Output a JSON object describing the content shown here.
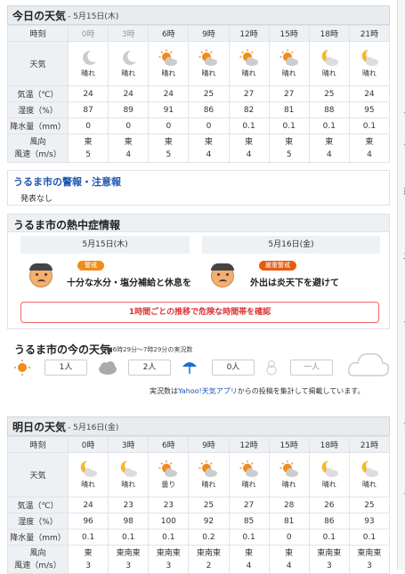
{
  "today": {
    "title": "今日の天気",
    "date": "- 5月15日(木)",
    "header_label": "時刻",
    "rows_labels": {
      "weather": "天気",
      "temp": "気温（℃）",
      "humidity": "湿度（%）",
      "precip": "降水量（mm）",
      "wind_dir": "風向",
      "wind_speed": "風速（m/s）"
    },
    "columns": [
      {
        "time": "0時",
        "dim": true,
        "icon": "moon-icon",
        "weather": "晴れ",
        "temp": "24",
        "humidity": "87",
        "precip": "0",
        "wind_dir": "東",
        "wind_speed": "5"
      },
      {
        "time": "3時",
        "dim": true,
        "icon": "moon-icon",
        "weather": "晴れ",
        "temp": "24",
        "humidity": "89",
        "precip": "0",
        "wind_dir": "東",
        "wind_speed": "4"
      },
      {
        "time": "6時",
        "dim": false,
        "icon": "sun-cloud-icon",
        "weather": "晴れ",
        "temp": "24",
        "humidity": "91",
        "precip": "0",
        "wind_dir": "東",
        "wind_speed": "5"
      },
      {
        "time": "9時",
        "dim": false,
        "icon": "sun-cloud-icon",
        "weather": "晴れ",
        "temp": "25",
        "humidity": "86",
        "precip": "0",
        "wind_dir": "東",
        "wind_speed": "4"
      },
      {
        "time": "12時",
        "dim": false,
        "icon": "sun-cloud-icon",
        "weather": "晴れ",
        "temp": "27",
        "humidity": "82",
        "precip": "0.1",
        "wind_dir": "東",
        "wind_speed": "4"
      },
      {
        "time": "15時",
        "dim": false,
        "icon": "sun-cloud-icon",
        "weather": "晴れ",
        "temp": "27",
        "humidity": "81",
        "precip": "0.1",
        "wind_dir": "東",
        "wind_speed": "5"
      },
      {
        "time": "18時",
        "dim": false,
        "icon": "moon-cloud-icon",
        "weather": "晴れ",
        "temp": "25",
        "humidity": "88",
        "precip": "0.1",
        "wind_dir": "東",
        "wind_speed": "4"
      },
      {
        "time": "21時",
        "dim": false,
        "icon": "moon-cloud-icon",
        "weather": "晴れ",
        "temp": "24",
        "humidity": "95",
        "precip": "0.1",
        "wind_dir": "東",
        "wind_speed": "4"
      }
    ]
  },
  "warnings": {
    "title": "うるま市の警報・注意報",
    "text": "発表なし"
  },
  "heat": {
    "title": "うるま市の熱中症情報",
    "day1": {
      "date": "5月15日(木)",
      "level": "警戒",
      "message": "十分な水分・塩分補給と休息を"
    },
    "day2": {
      "date": "5月16日(金)",
      "level": "厳重警戒",
      "message": "外出は炎天下を避けて"
    },
    "link": "1時間ごとの推移で危険な時間帯を確認"
  },
  "now": {
    "title": "うるま市の今の天気",
    "subtitle": "■6時29分〜7時29分の実況数",
    "counts": [
      "1人",
      "2人",
      "0人",
      "一人"
    ],
    "note_pre": "実況数は",
    "note_link": "Yahoo!天気アプリ",
    "note_post": "からの投稿を集計して掲載しています。"
  },
  "tomorrow": {
    "title": "明日の天気",
    "date": "- 5月16日(金)",
    "header_label": "時刻",
    "rows_labels": {
      "weather": "天気",
      "temp": "気温（℃）",
      "humidity": "湿度（%）",
      "precip": "降水量（mm）",
      "wind_dir": "風向",
      "wind_speed": "風速（m/s）"
    },
    "columns": [
      {
        "time": "0時",
        "icon": "moon-cloud-icon",
        "weather": "晴れ",
        "temp": "24",
        "humidity": "96",
        "precip": "0.1",
        "wind_dir": "東",
        "wind_speed": "3"
      },
      {
        "time": "3時",
        "icon": "moon-cloud-icon",
        "weather": "晴れ",
        "temp": "23",
        "humidity": "98",
        "precip": "0.1",
        "wind_dir": "東南東",
        "wind_speed": "3"
      },
      {
        "time": "6時",
        "icon": "sun-cloud-icon",
        "weather": "曇り",
        "temp": "23",
        "humidity": "100",
        "precip": "0.1",
        "wind_dir": "東南東",
        "wind_speed": "3"
      },
      {
        "time": "9時",
        "icon": "sun-cloud-icon",
        "weather": "晴れ",
        "temp": "25",
        "humidity": "92",
        "precip": "0.2",
        "wind_dir": "東南東",
        "wind_speed": "2"
      },
      {
        "time": "12時",
        "icon": "sun-cloud-icon",
        "weather": "晴れ",
        "temp": "27",
        "humidity": "85",
        "precip": "0.1",
        "wind_dir": "東",
        "wind_speed": "4"
      },
      {
        "time": "15時",
        "icon": "sun-cloud-icon",
        "weather": "晴れ",
        "temp": "28",
        "humidity": "81",
        "precip": "0",
        "wind_dir": "東",
        "wind_speed": "4"
      },
      {
        "time": "18時",
        "icon": "moon-cloud-icon",
        "weather": "晴れ",
        "temp": "26",
        "humidity": "86",
        "precip": "0.1",
        "wind_dir": "東南東",
        "wind_speed": "3"
      },
      {
        "time": "21時",
        "icon": "moon-cloud-icon",
        "weather": "晴れ",
        "temp": "25",
        "humidity": "93",
        "precip": "0.1",
        "wind_dir": "東南東",
        "wind_speed": "3"
      }
    ]
  },
  "colors": {
    "accent": "#1a55b0",
    "heat_warn": "#f08c1a",
    "heat_severe": "#e85a10",
    "link_red": "#d33333"
  }
}
